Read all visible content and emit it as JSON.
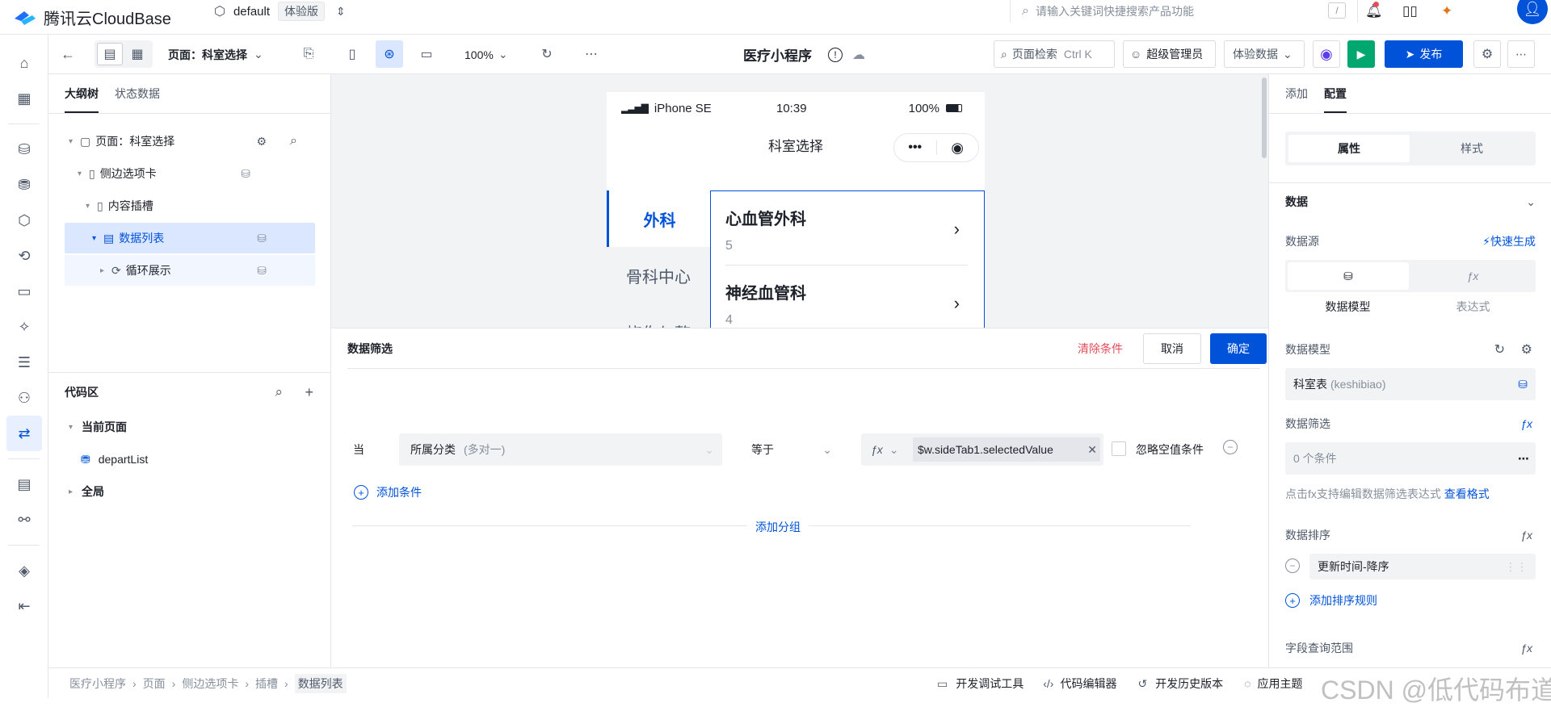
{
  "brand": {
    "name": "腾讯云CloudBase",
    "env": "default",
    "env_badge": "体验版"
  },
  "search": {
    "placeholder": "请输入关键词快捷搜索产品功能",
    "shortcut": "/"
  },
  "toolbar": {
    "page_label": "页面：科室选择",
    "zoom": "100%",
    "app_title": "医疗小程序",
    "page_search": "页面检索",
    "page_search_shortcut": "Ctrl K",
    "role": "超级管理员",
    "data_mode": "体验数据",
    "publish": "发布"
  },
  "left": {
    "tabs": [
      "大纲树",
      "状态数据"
    ],
    "tree": [
      {
        "label": "页面：科室选择"
      },
      {
        "label": "侧边选项卡"
      },
      {
        "label": "内容插槽"
      },
      {
        "label": "数据列表"
      },
      {
        "label": "循环展示"
      }
    ],
    "code": {
      "title": "代码区",
      "current_page": "当前页面",
      "item": "departList",
      "global": "全局"
    }
  },
  "phone": {
    "carrier": "iPhone SE",
    "time": "10:39",
    "battery": "100%",
    "title": "科室选择",
    "tabs": [
      "外科",
      "骨科中心",
      "烧伤与整"
    ],
    "items": [
      {
        "name": "心血管外科",
        "count": "5"
      },
      {
        "name": "神经血管科",
        "count": "4"
      }
    ]
  },
  "filter": {
    "title": "数据筛选",
    "clear": "清除条件",
    "cancel": "取消",
    "ok": "确定",
    "when": "当",
    "field": "所属分类",
    "field_hint": "(多对一)",
    "operator": "等于",
    "value": "$w.sideTab1.selectedValue",
    "ignore_empty": "忽略空值条件",
    "add_condition": "添加条件",
    "add_group": "添加分组"
  },
  "right": {
    "tabs": [
      "添加",
      "配置"
    ],
    "seg": [
      "属性",
      "样式"
    ],
    "data_section": "数据",
    "source_label": "数据源",
    "quick_gen": "快速生成",
    "source_opts": [
      "数据模型",
      "表达式"
    ],
    "model_label": "数据模型",
    "model_value": "科室表",
    "model_code": "(keshibiao)",
    "filter_label": "数据筛选",
    "filter_value": "0 个条件",
    "filter_help": "点击fx支持编辑数据筛选表达式",
    "filter_help_link": "查看格式",
    "sort_label": "数据排序",
    "sort_value": "更新时间-降序",
    "add_sort": "添加排序规则",
    "field_range": "字段查询范围"
  },
  "status": {
    "breadcrumb": [
      "医疗小程序",
      "页面",
      "侧边选项卡",
      "插槽",
      "数据列表"
    ],
    "tools": [
      "开发调试工具",
      "代码编辑器",
      "开发历史版本",
      "应用主题"
    ],
    "watermark": "CSDN @低代码布道师"
  },
  "colors": {
    "primary": "#0052d9",
    "success": "#00a870",
    "danger": "#e34d59",
    "selected_bg": "#dbe6ff"
  }
}
